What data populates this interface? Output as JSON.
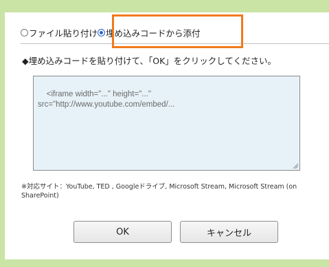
{
  "dialog": {
    "radio_options": [
      {
        "label": "ファイル貼り付け",
        "checked": false
      },
      {
        "label": "埋め込みコードから添付",
        "checked": true
      }
    ],
    "instruction": "◆埋め込みコードを貼り付けて、「OK」をクリックしてください。",
    "code_textarea": {
      "value": "<iframe width=\"...\" height=\"...\"\nsrc=\"http://www.youtube.com/embed/..."
    },
    "supported_sites_note": "※対応サイト：YouTube, TED , Googleドライブ, Microsoft Stream, Microsoft Stream (on SharePoint)",
    "ok_label": "OK",
    "cancel_label": "キャンセル"
  },
  "colors": {
    "accent_highlight": "#f07a1c",
    "frame_green": "#c9e4a4",
    "textarea_bg": "#e7f2f8",
    "radio_selected": "#2b62c8"
  }
}
